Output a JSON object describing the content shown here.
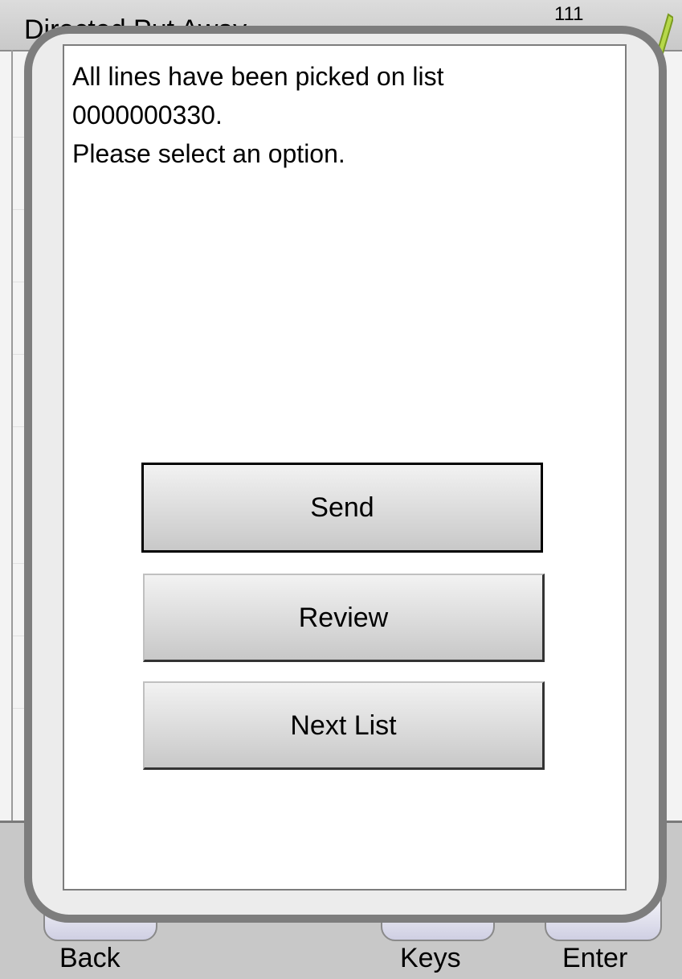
{
  "app": {
    "title": "Directed Put Away",
    "signal": "111"
  },
  "dialog": {
    "message": "All lines have been picked on list\n0000000330.\nPlease select an option.",
    "buttons": {
      "send": "Send",
      "review": "Review",
      "next_list": "Next List"
    },
    "focused_button": "send"
  },
  "softkeys": {
    "back": "Back",
    "keys": "Keys",
    "enter": "Enter"
  },
  "colors": {
    "dialog_border": "#7d7d7d",
    "back_key_mark": "#cc0000",
    "enter_key_mark": "#cc2222"
  }
}
